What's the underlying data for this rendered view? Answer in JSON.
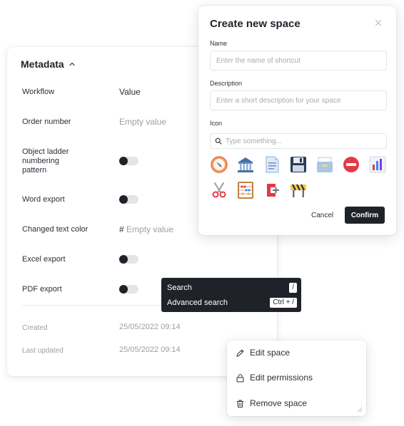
{
  "metadata": {
    "title": "Metadata",
    "rows": [
      {
        "label": "Workflow",
        "value": "Value"
      },
      {
        "label": "Order number",
        "value": "Empty value"
      },
      {
        "label": "Object ladder numbering pattern",
        "toggle": false
      },
      {
        "label": "Word export",
        "toggle": false
      },
      {
        "label": "Changed text color",
        "value_prefix": "#",
        "value": "Empty value"
      },
      {
        "label": "Excel export",
        "toggle": false
      },
      {
        "label": "PDF export",
        "toggle": false
      },
      {
        "label": "Created",
        "value": "25/05/2022 09:14"
      },
      {
        "label": "Last updated",
        "value": "25/05/2022 09:14"
      }
    ]
  },
  "modal": {
    "title": "Create new space",
    "name_label": "Name",
    "name_placeholder": "Enter the name of shortcut",
    "description_label": "Description",
    "description_placeholder": "Enter a short description for your space",
    "icon_label": "Icon",
    "icon_search_placeholder": "Type something...",
    "icons": [
      "compass-icon",
      "bank-icon",
      "document-icon",
      "floppy-disk-icon",
      "card-file-box-icon",
      "no-entry-icon",
      "bar-chart-icon",
      "scissors-icon",
      "abacus-icon",
      "clamp-icon",
      "construction-barrier-icon"
    ],
    "cancel_label": "Cancel",
    "confirm_label": "Confirm"
  },
  "search_popover": {
    "items": [
      {
        "label": "Search",
        "shortcut": "/"
      },
      {
        "label": "Advanced search",
        "shortcut": "Ctrl + /"
      }
    ]
  },
  "context_menu": {
    "items": [
      {
        "label": "Edit space",
        "icon": "pencil-icon"
      },
      {
        "label": "Edit permissions",
        "icon": "lock-icon"
      },
      {
        "label": "Remove space",
        "icon": "trash-icon"
      }
    ]
  },
  "colors": {
    "primary_dark": "#1f2329",
    "muted_text": "#9aa0a8",
    "toggle_track": "#e3e5e8",
    "border": "#e3e5e8"
  }
}
